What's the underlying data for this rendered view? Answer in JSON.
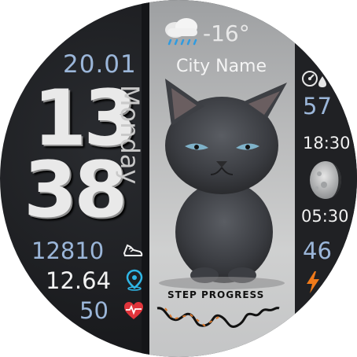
{
  "date": "20.01",
  "time": {
    "hour": "13",
    "minute": "38"
  },
  "weekday": "Monday",
  "weather": {
    "temperature": "-16°",
    "city": "City Name",
    "icon": "cloud-rain-icon"
  },
  "stats": {
    "steps": "12810",
    "distance": "12.64",
    "heart_rate": "50"
  },
  "right_column": {
    "battery": "57",
    "sunset": "18:30",
    "sunrise": "05:30",
    "power": "46"
  },
  "step_progress": {
    "label": "STEP PROGRESS"
  },
  "colors": {
    "accent_blue": "#9bb6d9",
    "heart_red": "#e0343b",
    "bolt_orange": "#f07a1a",
    "location_cyan": "#2fb6e6"
  }
}
